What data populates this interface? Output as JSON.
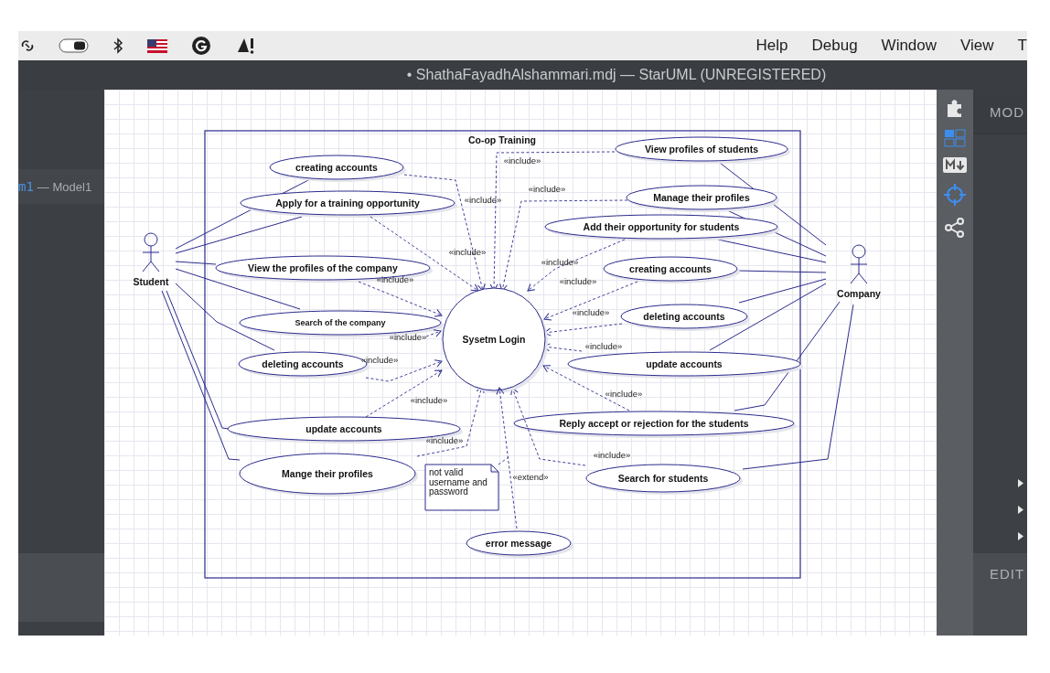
{
  "menu_bar": {
    "items": [
      "Help",
      "Debug",
      "Window",
      "View",
      "T"
    ]
  },
  "title_bar": {
    "title": "• ShathaFayadhAlshammari.mdj — StarUML (UNREGISTERED)"
  },
  "model_explorer": {
    "item_prefix": "m1",
    "item_label": "— Model1"
  },
  "right_panel": {
    "header": "MOD",
    "footer": "EDIT"
  },
  "diagram": {
    "boundary": "Co-op Training",
    "actors": [
      {
        "name": "Student"
      },
      {
        "name": "Company"
      }
    ],
    "system_use_case": "Sysetm Login",
    "student_use_cases": [
      {
        "label": "creating accounts",
        "relation": "«include»"
      },
      {
        "label": "Apply for a training opportunity",
        "relation": "«include»"
      },
      {
        "label": "View the profiles of the company",
        "relation": "«include»"
      },
      {
        "label": "Search of the company",
        "relation": "«include»"
      },
      {
        "label": "deleting accounts",
        "relation": "«include»"
      },
      {
        "label": "update accounts",
        "relation": "«include»"
      },
      {
        "label": "Mange their profiles",
        "relation": "«include»"
      }
    ],
    "company_use_cases": [
      {
        "label": "View profiles of students",
        "relation": "«include»"
      },
      {
        "label": "Manage their profiles",
        "relation": "«include»"
      },
      {
        "label": "Add their opportunity for students",
        "relation": "«include»"
      },
      {
        "label": "creating accounts",
        "relation": "«include»"
      },
      {
        "label": "deleting accounts",
        "relation": "«include»"
      },
      {
        "label": "update accounts",
        "relation": "«include»"
      },
      {
        "label": "Reply accept or rejection for the students",
        "relation": "«include»"
      },
      {
        "label": "Search for students",
        "relation": "«include»"
      }
    ],
    "extension": {
      "label": "error message",
      "relation": "«extend»"
    },
    "note": {
      "lines": [
        "not valid",
        "username and",
        "password"
      ]
    }
  }
}
